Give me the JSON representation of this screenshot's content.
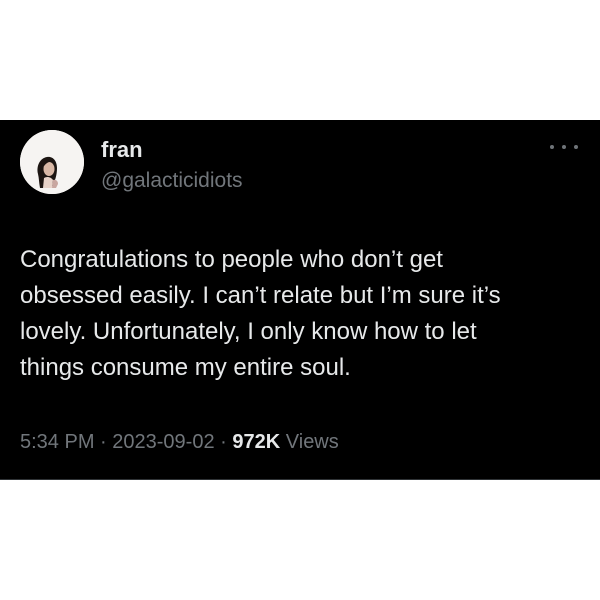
{
  "tweet": {
    "author": {
      "name": "fran",
      "handle": "@galacticidiots"
    },
    "text_lines": [
      "Congratulations to people who don’t get",
      "obsessed easily. I can’t relate but I’m sure it’s",
      "lovely. Unfortunately, I only know how to let",
      "things consume my entire soul."
    ],
    "time": "5:34 PM",
    "date": "2023-09-02",
    "separator": "·",
    "views_count": "972K",
    "views_label": "Views"
  },
  "icons": {
    "avatar": "profile-photo",
    "more": "more-horizontal-icon"
  },
  "colors": {
    "card_background": "#000000",
    "primary_text": "#e7e9ea",
    "secondary_text": "#71767b",
    "page_background": "#ffffff"
  }
}
